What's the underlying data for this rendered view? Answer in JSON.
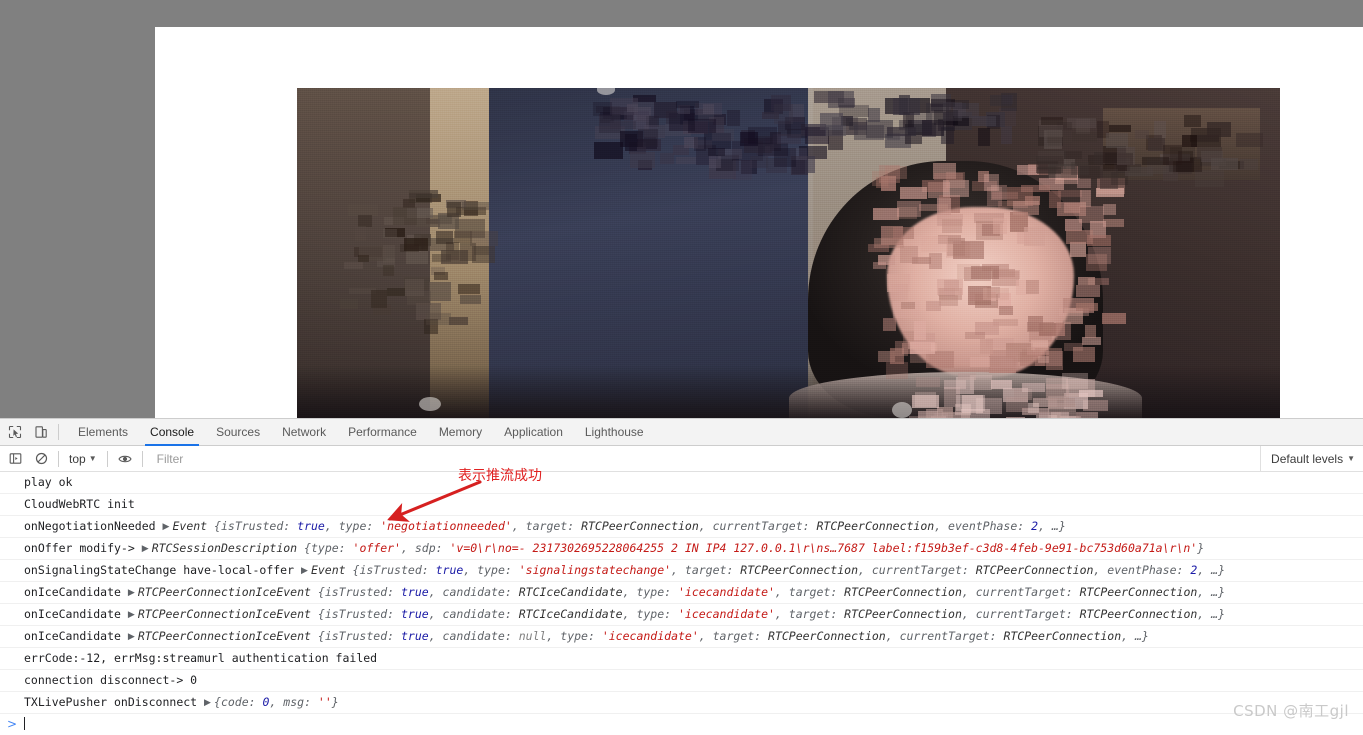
{
  "window": {
    "page_background": "#ffffff",
    "chrome_background": "#808080"
  },
  "devtools": {
    "icons": {
      "inspect": "inspect-element-icon",
      "device": "device-toolbar-icon",
      "sidebar": "console-sidebar-icon",
      "clear": "clear-console-icon",
      "eye": "live-expression-icon"
    },
    "tabs": [
      {
        "label": "Elements",
        "active": false
      },
      {
        "label": "Console",
        "active": true
      },
      {
        "label": "Sources",
        "active": false
      },
      {
        "label": "Network",
        "active": false
      },
      {
        "label": "Performance",
        "active": false
      },
      {
        "label": "Memory",
        "active": false
      },
      {
        "label": "Application",
        "active": false
      },
      {
        "label": "Lighthouse",
        "active": false
      }
    ],
    "filter_bar": {
      "context": "top",
      "filter_placeholder": "Filter",
      "filter_value": "",
      "levels": "Default levels"
    },
    "prompt": ">"
  },
  "console": {
    "rows": [
      {
        "id": "play-ok",
        "parts": [
          {
            "t": "plain",
            "v": "play ok"
          }
        ]
      },
      {
        "id": "cloudwebrtc-init",
        "parts": [
          {
            "t": "plain",
            "v": "CloudWebRTC init"
          }
        ]
      },
      {
        "id": "on-negotiation-needed",
        "parts": [
          {
            "t": "plain",
            "v": "onNegotiationNeeded "
          },
          {
            "t": "disclosure",
            "v": "▶"
          },
          {
            "t": "class",
            "v": "Event "
          },
          {
            "t": "punct",
            "v": "{"
          },
          {
            "t": "prop",
            "v": "isTrusted: "
          },
          {
            "t": "bool",
            "v": "true"
          },
          {
            "t": "punct",
            "v": ", "
          },
          {
            "t": "prop",
            "v": "type: "
          },
          {
            "t": "str",
            "v": "'negotiationneeded'"
          },
          {
            "t": "punct",
            "v": ", "
          },
          {
            "t": "prop",
            "v": "target: "
          },
          {
            "t": "class",
            "v": "RTCPeerConnection"
          },
          {
            "t": "punct",
            "v": ", "
          },
          {
            "t": "prop",
            "v": "currentTarget: "
          },
          {
            "t": "class",
            "v": "RTCPeerConnection"
          },
          {
            "t": "punct",
            "v": ", "
          },
          {
            "t": "prop",
            "v": "eventPhase: "
          },
          {
            "t": "num",
            "v": "2"
          },
          {
            "t": "punct",
            "v": ", …}"
          }
        ]
      },
      {
        "id": "on-offer-modify",
        "parts": [
          {
            "t": "plain",
            "v": "onOffer modify-> "
          },
          {
            "t": "disclosure",
            "v": "▶"
          },
          {
            "t": "class",
            "v": "RTCSessionDescription "
          },
          {
            "t": "punct",
            "v": "{"
          },
          {
            "t": "prop",
            "v": "type: "
          },
          {
            "t": "str",
            "v": "'offer'"
          },
          {
            "t": "punct",
            "v": ", "
          },
          {
            "t": "prop",
            "v": "sdp: "
          },
          {
            "t": "str",
            "v": "'v=0\\r\\no=- 2317302695228064255 2 IN IP4 127.0.0.1\\r\\ns…7687 label:f159b3ef-c3d8-4feb-9e91-bc753d60a71a\\r\\n'"
          },
          {
            "t": "punct",
            "v": "}"
          }
        ]
      },
      {
        "id": "on-signaling-state-change",
        "parts": [
          {
            "t": "plain",
            "v": "onSignalingStateChange have-local-offer "
          },
          {
            "t": "disclosure",
            "v": "▶"
          },
          {
            "t": "class",
            "v": "Event "
          },
          {
            "t": "punct",
            "v": "{"
          },
          {
            "t": "prop",
            "v": "isTrusted: "
          },
          {
            "t": "bool",
            "v": "true"
          },
          {
            "t": "punct",
            "v": ", "
          },
          {
            "t": "prop",
            "v": "type: "
          },
          {
            "t": "str",
            "v": "'signalingstatechange'"
          },
          {
            "t": "punct",
            "v": ", "
          },
          {
            "t": "prop",
            "v": "target: "
          },
          {
            "t": "class",
            "v": "RTCPeerConnection"
          },
          {
            "t": "punct",
            "v": ", "
          },
          {
            "t": "prop",
            "v": "currentTarget: "
          },
          {
            "t": "class",
            "v": "RTCPeerConnection"
          },
          {
            "t": "punct",
            "v": ", "
          },
          {
            "t": "prop",
            "v": "eventPhase: "
          },
          {
            "t": "num",
            "v": "2"
          },
          {
            "t": "punct",
            "v": ", …}"
          }
        ]
      },
      {
        "id": "on-ice-candidate-1",
        "parts": [
          {
            "t": "plain",
            "v": "onIceCandidate "
          },
          {
            "t": "disclosure",
            "v": "▶"
          },
          {
            "t": "class",
            "v": "RTCPeerConnectionIceEvent "
          },
          {
            "t": "punct",
            "v": "{"
          },
          {
            "t": "prop",
            "v": "isTrusted: "
          },
          {
            "t": "bool",
            "v": "true"
          },
          {
            "t": "punct",
            "v": ", "
          },
          {
            "t": "prop",
            "v": "candidate: "
          },
          {
            "t": "class",
            "v": "RTCIceCandidate"
          },
          {
            "t": "punct",
            "v": ", "
          },
          {
            "t": "prop",
            "v": "type: "
          },
          {
            "t": "str",
            "v": "'icecandidate'"
          },
          {
            "t": "punct",
            "v": ", "
          },
          {
            "t": "prop",
            "v": "target: "
          },
          {
            "t": "class",
            "v": "RTCPeerConnection"
          },
          {
            "t": "punct",
            "v": ", "
          },
          {
            "t": "prop",
            "v": "currentTarget: "
          },
          {
            "t": "class",
            "v": "RTCPeerConnection"
          },
          {
            "t": "punct",
            "v": ", …}"
          }
        ]
      },
      {
        "id": "on-ice-candidate-2",
        "parts": [
          {
            "t": "plain",
            "v": "onIceCandidate "
          },
          {
            "t": "disclosure",
            "v": "▶"
          },
          {
            "t": "class",
            "v": "RTCPeerConnectionIceEvent "
          },
          {
            "t": "punct",
            "v": "{"
          },
          {
            "t": "prop",
            "v": "isTrusted: "
          },
          {
            "t": "bool",
            "v": "true"
          },
          {
            "t": "punct",
            "v": ", "
          },
          {
            "t": "prop",
            "v": "candidate: "
          },
          {
            "t": "class",
            "v": "RTCIceCandidate"
          },
          {
            "t": "punct",
            "v": ", "
          },
          {
            "t": "prop",
            "v": "type: "
          },
          {
            "t": "str",
            "v": "'icecandidate'"
          },
          {
            "t": "punct",
            "v": ", "
          },
          {
            "t": "prop",
            "v": "target: "
          },
          {
            "t": "class",
            "v": "RTCPeerConnection"
          },
          {
            "t": "punct",
            "v": ", "
          },
          {
            "t": "prop",
            "v": "currentTarget: "
          },
          {
            "t": "class",
            "v": "RTCPeerConnection"
          },
          {
            "t": "punct",
            "v": ", …}"
          }
        ]
      },
      {
        "id": "on-ice-candidate-3",
        "parts": [
          {
            "t": "plain",
            "v": "onIceCandidate "
          },
          {
            "t": "disclosure",
            "v": "▶"
          },
          {
            "t": "class",
            "v": "RTCPeerConnectionIceEvent "
          },
          {
            "t": "punct",
            "v": "{"
          },
          {
            "t": "prop",
            "v": "isTrusted: "
          },
          {
            "t": "bool",
            "v": "true"
          },
          {
            "t": "punct",
            "v": ", "
          },
          {
            "t": "prop",
            "v": "candidate: "
          },
          {
            "t": "null",
            "v": "null"
          },
          {
            "t": "punct",
            "v": ", "
          },
          {
            "t": "prop",
            "v": "type: "
          },
          {
            "t": "str",
            "v": "'icecandidate'"
          },
          {
            "t": "punct",
            "v": ", "
          },
          {
            "t": "prop",
            "v": "target: "
          },
          {
            "t": "class",
            "v": "RTCPeerConnection"
          },
          {
            "t": "punct",
            "v": ", "
          },
          {
            "t": "prop",
            "v": "currentTarget: "
          },
          {
            "t": "class",
            "v": "RTCPeerConnection"
          },
          {
            "t": "punct",
            "v": ", …}"
          }
        ]
      },
      {
        "id": "err-code",
        "parts": [
          {
            "t": "plain",
            "v": "errCode:-12, errMsg:streamurl authentication failed"
          }
        ]
      },
      {
        "id": "connection-disconnect",
        "parts": [
          {
            "t": "plain",
            "v": "connection disconnect-> 0"
          }
        ]
      },
      {
        "id": "txlivepusher-ondisconnect",
        "parts": [
          {
            "t": "plain",
            "v": "TXLivePusher onDisconnect "
          },
          {
            "t": "disclosure",
            "v": "▶"
          },
          {
            "t": "punct",
            "v": "{"
          },
          {
            "t": "prop",
            "v": "code: "
          },
          {
            "t": "num",
            "v": "0"
          },
          {
            "t": "punct",
            "v": ", "
          },
          {
            "t": "prop",
            "v": "msg: "
          },
          {
            "t": "str",
            "v": "''"
          },
          {
            "t": "punct",
            "v": "}"
          }
        ]
      }
    ]
  },
  "annotation": {
    "text": "表示推流成功",
    "color": "#e02020"
  },
  "watermark": {
    "text": "CSDN @南工gjl",
    "color": "#c9c9c9"
  }
}
